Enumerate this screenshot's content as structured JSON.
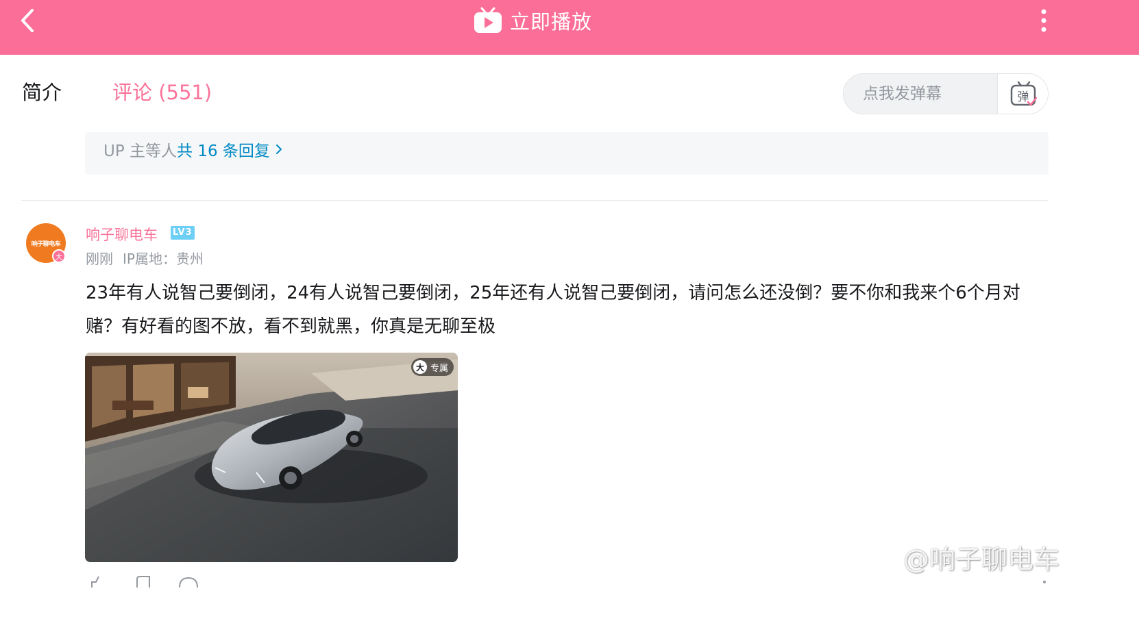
{
  "colors": {
    "header_bg": "#fb6e98",
    "accent_pink": "#fb7299",
    "link_blue": "#008ac5",
    "avatar_orange": "#f07a1f",
    "level_badge": "#6ecff6"
  },
  "header": {
    "back_icon": "chevron-left-icon",
    "play_icon": "tv-play-icon",
    "play_label": "立即播放",
    "more_icon": "more-vertical-icon"
  },
  "tabs": [
    {
      "label": "简介",
      "active": false
    },
    {
      "label": "评论 (551)",
      "active": true
    }
  ],
  "danmaku": {
    "placeholder": "点我发弹幕",
    "toggle_icon": "danmaku-toggle-icon",
    "toggle_glyph": "弹"
  },
  "reply_summary": {
    "prefix": "UP 主等人",
    "link": "共 16 条回复"
  },
  "comment": {
    "avatar_text": "响子聊电车",
    "avatar_badge": "大",
    "username": "响子聊电车",
    "level": "LV3",
    "time": "刚刚",
    "ip_location": "IP属地：贵州",
    "text": "23年有人说智己要倒闭，24有人说智己要倒闭，25年还有人说智己要倒闭，请问怎么还没倒？要不你和我来个6个月对赌？有好看的图不放，看不到就黑，你真是无聊至极",
    "image_alt": "silver electric sedan parked outside modern glass house",
    "image_tag_badge": "大",
    "image_tag_label": "专属"
  },
  "watermark": {
    "icon": "weibo-logo-icon",
    "text": "@响子聊电车"
  }
}
